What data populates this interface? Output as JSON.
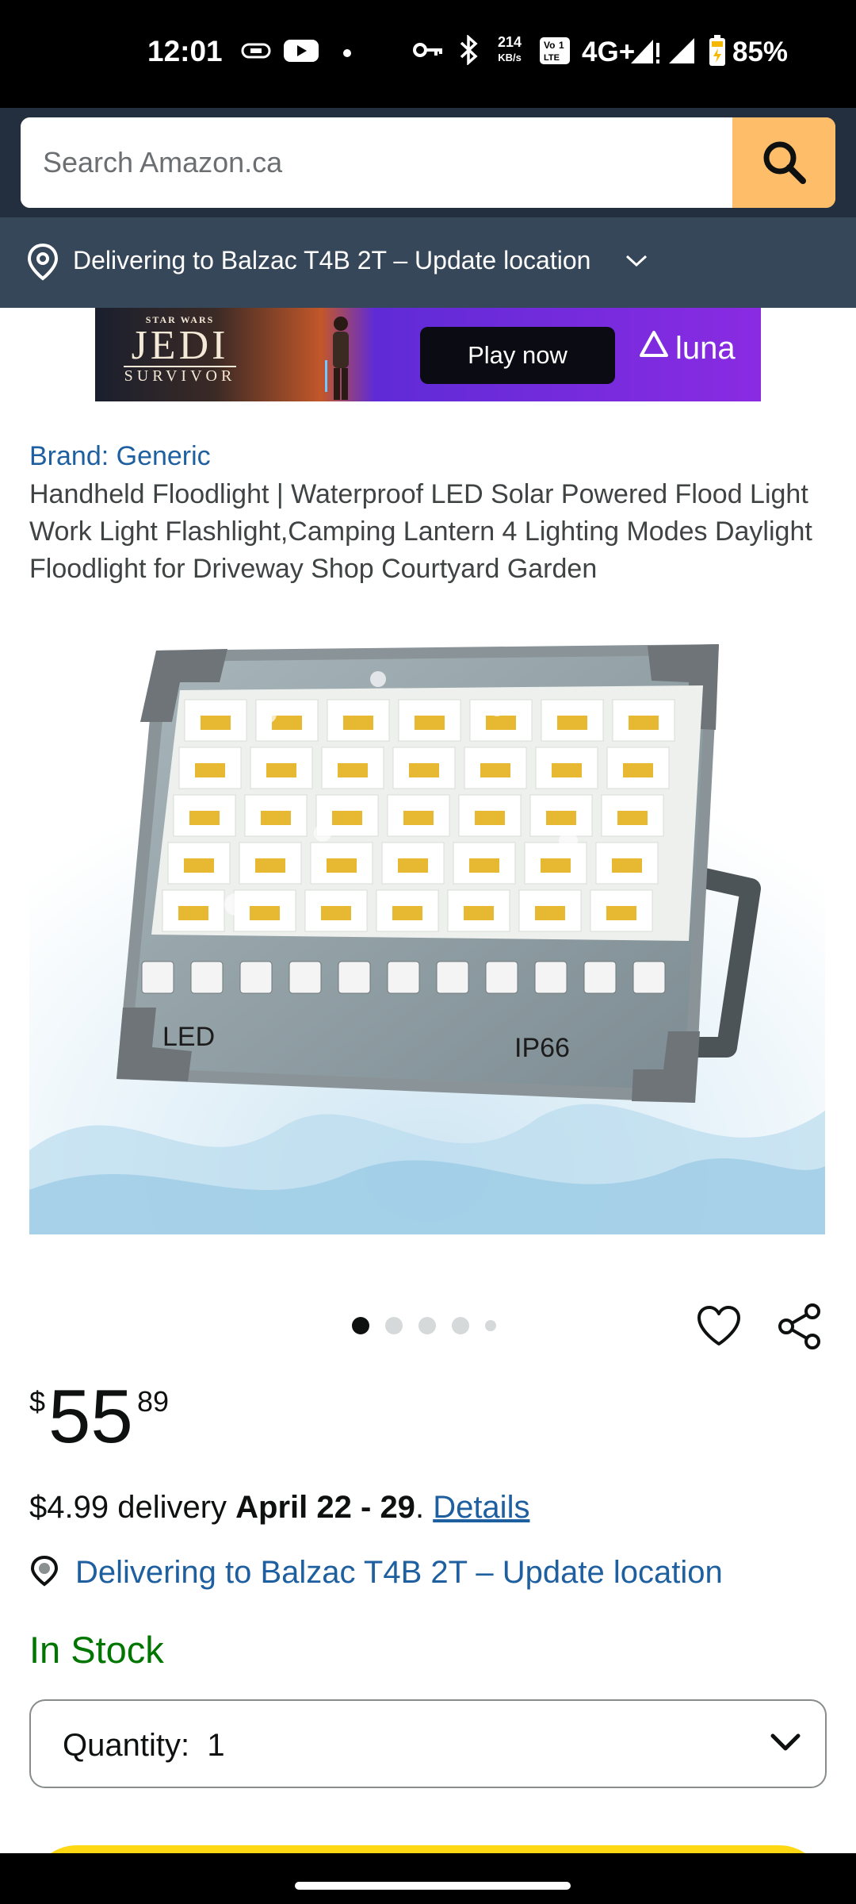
{
  "status_bar": {
    "time": "12:01",
    "speed_value": "214",
    "speed_unit": "KB/s",
    "network": "4G+",
    "battery": "85%"
  },
  "search": {
    "placeholder": "Search Amazon.ca",
    "value": ""
  },
  "header_delivery": {
    "text": "Delivering to Balzac T4B 2T – Update location"
  },
  "ad": {
    "game_top": "STAR WARS",
    "game_title": "JEDI",
    "game_subtitle": "SURVIVOR",
    "button_label": "Play now",
    "brand": "luna"
  },
  "product": {
    "brand": "Brand: Generic",
    "title": "Handheld Floodlight | Waterproof LED Solar Powered Flood Light Work Light Flashlight,Camping Lantern 4 Lighting Modes Daylight Floodlight for Driveway Shop Courtyard Garden",
    "image_labels": {
      "left": "LED",
      "right": "IP66"
    },
    "image_count": 5,
    "active_image": 1
  },
  "price": {
    "currency": "$",
    "whole": "55",
    "fraction": "89"
  },
  "delivery": {
    "cost": "$4.99 delivery",
    "dates": "April 22 - 29",
    "period": ".",
    "details_link": "Details"
  },
  "location_line": "Delivering to Balzac T4B 2T – Update location",
  "stock": "In Stock",
  "quantity": {
    "label": "Quantity:",
    "value": "1"
  },
  "colors": {
    "header_bg": "#232f3e",
    "delivery_bar_bg": "#37475a",
    "search_button": "#febd69",
    "link": "#1e5fa0",
    "in_stock": "#007600",
    "cart_button": "#ffd814"
  }
}
